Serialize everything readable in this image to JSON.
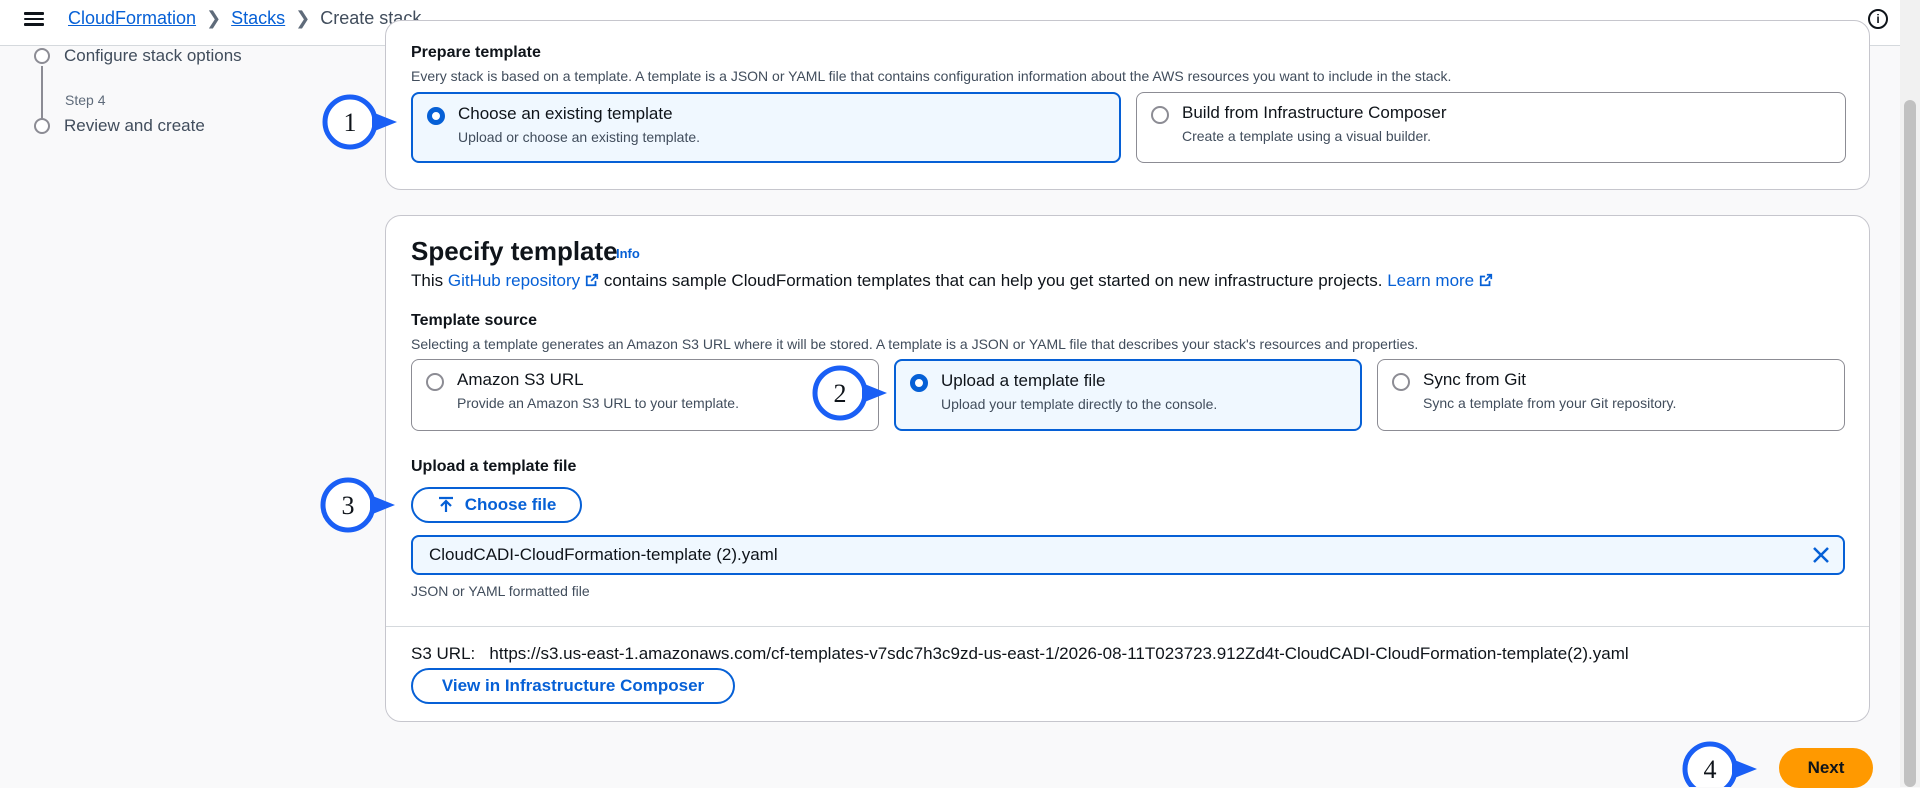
{
  "breadcrumb": {
    "items": [
      "CloudFormation",
      "Stacks"
    ],
    "current": "Create stack"
  },
  "steps": {
    "configure": "Configure stack options",
    "step4_label": "Step 4",
    "review": "Review and create"
  },
  "prepare_template": {
    "label": "Prepare template",
    "description": "Every stack is based on a template. A template is a JSON or YAML file that contains configuration information about the AWS resources you want to include in the stack.",
    "options": [
      {
        "title": "Choose an existing template",
        "desc": "Upload or choose an existing template.",
        "selected": true
      },
      {
        "title": "Build from Infrastructure Composer",
        "desc": "Create a template using a visual builder.",
        "selected": false
      }
    ]
  },
  "specify_template": {
    "heading": "Specify template",
    "info": "Info",
    "intro_prefix": "This ",
    "github_link": "GitHub repository",
    "intro_middle": " contains sample CloudFormation templates that can help you get started on new infrastructure projects. ",
    "learn_more": "Learn more",
    "source_label": "Template source",
    "source_desc": "Selecting a template generates an Amazon S3 URL where it will be stored. A template is a JSON or YAML file that describes your stack's resources and properties.",
    "sources": [
      {
        "title": "Amazon S3 URL",
        "desc": "Provide an Amazon S3 URL to your template.",
        "selected": false
      },
      {
        "title": "Upload a template file",
        "desc": "Upload your template directly to the console.",
        "selected": true
      },
      {
        "title": "Sync from Git",
        "desc": "Sync a template from your Git repository.",
        "selected": false
      }
    ],
    "upload_label": "Upload a template file",
    "choose_file": "Choose file",
    "file_name": "CloudCADI-CloudFormation-template (2).yaml",
    "file_hint": "JSON or YAML formatted file",
    "s3_label": "S3 URL:",
    "s3_url": "https://s3.us-east-1.amazonaws.com/cf-templates-v7sdc7h3c9zd-us-east-1/2026-08-11T023723.912Zd4t-CloudCADI-CloudFormation-template(2).yaml",
    "view_composer": "View in Infrastructure Composer"
  },
  "callouts": [
    "1",
    "2",
    "3",
    "4"
  ],
  "footer": {
    "next": "Next"
  },
  "colors": {
    "accent": "#0660d6",
    "next_button": "#ff9900",
    "callout_blue": "#1a5ff5"
  },
  "icons": [
    "menu-icon",
    "info-icon",
    "external-link-icon",
    "upload-icon",
    "close-icon"
  ]
}
